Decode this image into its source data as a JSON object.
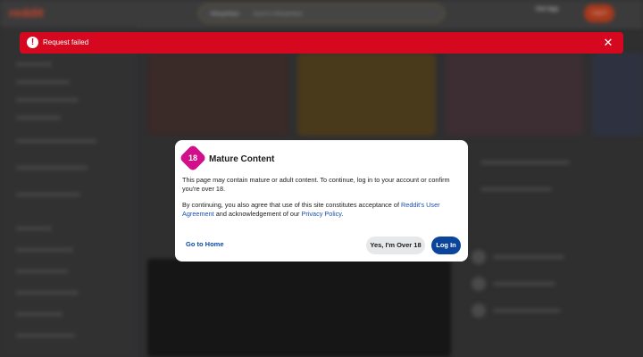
{
  "background": {
    "logo": "reddit",
    "search_scope": "r/MangaHelper",
    "search_placeholder": "Search in r/MangaHelper",
    "get_app_label": "Get App",
    "login_label": "Log In"
  },
  "toast": {
    "icon": "exclamation-icon",
    "message": "Request failed",
    "close_icon": "close-icon"
  },
  "modal": {
    "badge": "18",
    "title": "Mature Content",
    "paragraph1": "This page may contain mature or adult content. To continue, log in to your account or confirm you're over 18.",
    "paragraph2_prefix": "By continuing, you also agree that use of this site constitutes acceptance of ",
    "user_agreement_link": "Reddit's User Agreement",
    "paragraph2_middle": " and acknowledgement of our ",
    "privacy_policy_link": "Privacy Policy",
    "paragraph2_suffix": ".",
    "go_home_label": "Go to Home",
    "over18_label": "Yes, I'm Over 18",
    "login_label": "Log In"
  },
  "colors": {
    "toast_bg": "#d6081f",
    "badge_bg": "#d20f8b",
    "login_btn": "#0a449b",
    "link": "#1a4fb0"
  }
}
